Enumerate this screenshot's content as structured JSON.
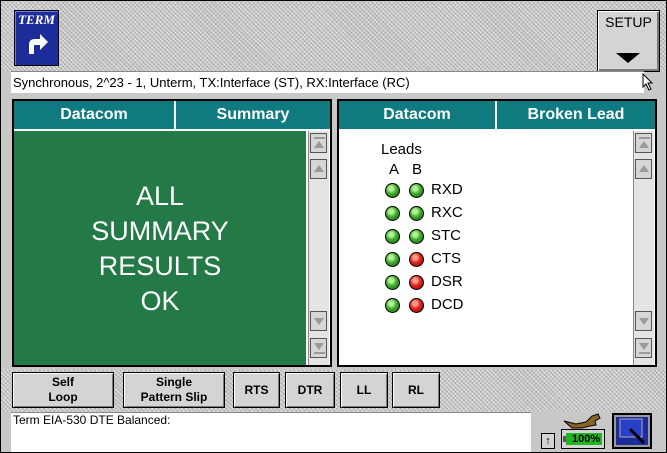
{
  "header": {
    "term_label": "TERM",
    "setup_label": "SETUP"
  },
  "status_line": "Synchronous, 2^23 - 1, Unterm, TX:Interface (ST), RX:Interface (RC)",
  "left_panel": {
    "tabs": [
      "Datacom",
      "Summary"
    ],
    "summary_lines": [
      "ALL",
      "SUMMARY",
      "RESULTS",
      "OK"
    ],
    "background_color": "#237a47"
  },
  "right_panel": {
    "tabs": [
      "Datacom",
      "Broken Lead"
    ],
    "leads_title": "Leads",
    "column_a": "A",
    "column_b": "B",
    "leads": [
      {
        "name": "RXD",
        "a": "green",
        "b": "green"
      },
      {
        "name": "RXC",
        "a": "green",
        "b": "green"
      },
      {
        "name": "STC",
        "a": "green",
        "b": "green"
      },
      {
        "name": "CTS",
        "a": "green",
        "b": "red"
      },
      {
        "name": "DSR",
        "a": "green",
        "b": "red"
      },
      {
        "name": "DCD",
        "a": "green",
        "b": "red"
      }
    ]
  },
  "bottom_buttons": [
    {
      "id": "self-loop",
      "label": "Self\nLoop"
    },
    {
      "id": "single-pattern-slip",
      "label": "Single\nPattern Slip"
    },
    {
      "id": "rts",
      "label": "RTS"
    },
    {
      "id": "dtr",
      "label": "DTR"
    },
    {
      "id": "ll",
      "label": "LL"
    },
    {
      "id": "rl",
      "label": "RL"
    }
  ],
  "message": "Term EIA-530 DTE Balanced:",
  "battery_text": "100%",
  "battery_level_percent": 100,
  "colors": {
    "tab_teal": "#0f7a7f",
    "term_blue": "#1c2d9a",
    "led_green": "#3fae2c",
    "led_red": "#e1221b"
  },
  "icons": {
    "term": "curved-arrow-icon",
    "setup": "triangle-down-icon",
    "cursor": "mouse-pointer-icon",
    "wrench": "wrench-icon",
    "monitor": "monitor-icon",
    "battery": "battery-icon",
    "up": "arrow-up-icon"
  }
}
